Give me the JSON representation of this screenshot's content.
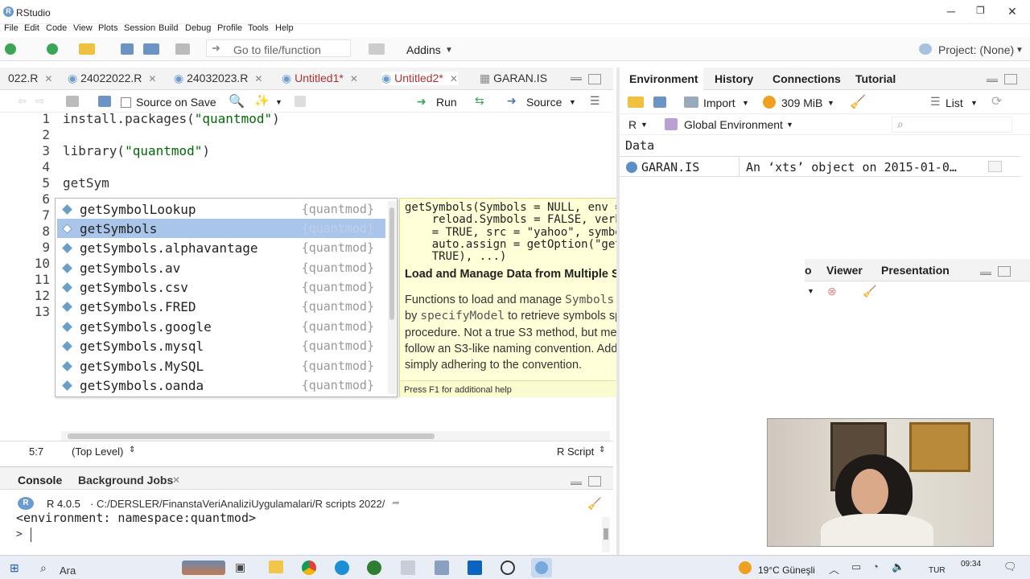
{
  "window": {
    "title": "RStudio"
  },
  "menu": [
    "File",
    "Edit",
    "Code",
    "View",
    "Plots",
    "Session",
    "Build",
    "Debug",
    "Profile",
    "Tools",
    "Help"
  ],
  "toolbar": {
    "goto_placeholder": "Go to file/function",
    "addins": "Addins",
    "project": "Project: (None)"
  },
  "editor_tabs": [
    {
      "label": "022.R"
    },
    {
      "label": "24022022.R"
    },
    {
      "label": "24032023.R"
    },
    {
      "label": "Untitled1*"
    },
    {
      "label": "Untitled2*"
    },
    {
      "label": "GARAN.IS"
    }
  ],
  "editor_toolbar": {
    "source_on_save": "Source on Save",
    "run": "Run",
    "source": "Source"
  },
  "code_lines": [
    "1",
    "2",
    "3",
    "4",
    "5",
    "6",
    "7",
    "8",
    "9",
    "10",
    "11",
    "12",
    "13"
  ],
  "code": {
    "l1_fn": "install.packages(",
    "l1_str": "\"quantmod\"",
    "l1_end": ")",
    "l3_fn": "library(",
    "l3_str": "\"quantmod\"",
    "l3_end": ")",
    "l5": "getSym"
  },
  "autocomplete": [
    {
      "name": "getSymbolLookup",
      "pkg": "{quantmod}"
    },
    {
      "name": "getSymbols",
      "pkg": "{quantmod}"
    },
    {
      "name": "getSymbols.alphavantage",
      "pkg": "{quantmod}"
    },
    {
      "name": "getSymbols.av",
      "pkg": "{quantmod}"
    },
    {
      "name": "getSymbols.csv",
      "pkg": "{quantmod}"
    },
    {
      "name": "getSymbols.FRED",
      "pkg": "{quantmod}"
    },
    {
      "name": "getSymbols.google",
      "pkg": "{quantmod}"
    },
    {
      "name": "getSymbols.mysql",
      "pkg": "{quantmod}"
    },
    {
      "name": "getSymbols.MySQL",
      "pkg": "{quantmod}"
    },
    {
      "name": "getSymbols.oanda",
      "pkg": "{quantmod}"
    }
  ],
  "help": {
    "signature": "getSymbols(Symbols = NULL, env = parent.frame(),\n    reload.Symbols = FALSE, verbose = FALSE, warnings\n    = TRUE, src = \"yahoo\", symbol.lookup = TRUE,\n    auto.assign = getOption(\"getSymbols.auto.assign\",\n    TRUE), ...)",
    "title": "Load and Manage Data from Multiple Sources",
    "d1": "Functions to load and manage ",
    "d1_code": "Symbols",
    "d2": " in specified environment. Used by ",
    "d2_code": "specifyModel",
    "d3": " to retrieve symbols specified in first step of modelling procedure. Not a true S3 method, but methods for different data sources follow an S3-like naming convention. Additional methods can be added by simply adhering to the convention.",
    "f1": "Press F1 for additional help"
  },
  "status": {
    "pos": "5:7",
    "level": "(Top Level)",
    "type": "R Script"
  },
  "console": {
    "tab1": "Console",
    "tab2": "Background Jobs",
    "version": "R 4.0.5",
    "path": "C:/DERSLER/FinanstaVeriAnaliziUygulamalari/R scripts 2022/",
    "output": "<environment: namespace:quantmod>",
    "prompt": ">"
  },
  "env_tabs": [
    "Environment",
    "History",
    "Connections",
    "Tutorial"
  ],
  "env_toolbar": {
    "import": "Import",
    "memory": "309 MiB",
    "list": "List",
    "lang": "R",
    "scope": "Global Environment"
  },
  "env": {
    "section": "Data",
    "name": "GARAN.IS",
    "value": "An ‘xts’ object on 2015-01-0…"
  },
  "lower_tabs": [
    "Viewer",
    "Presentation"
  ],
  "lower_tab_partial": "o",
  "taskbar": {
    "search": "Ara",
    "weather": "19°C Güneşli",
    "lang": "TUR",
    "time": "09:34"
  },
  "colors": {
    "selection": "#aac5ea",
    "help_bg": "#ffffd8",
    "string": "#036A07",
    "modified_tab": "#b03030"
  }
}
